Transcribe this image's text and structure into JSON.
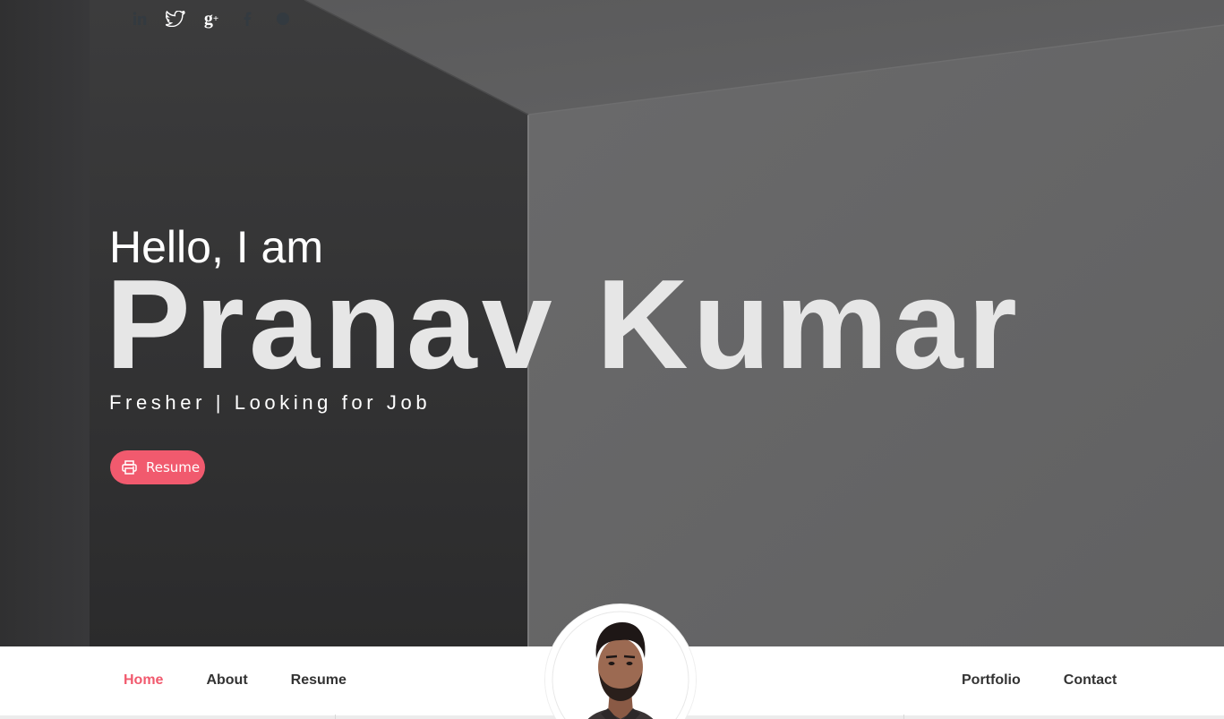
{
  "social": {
    "icons": [
      "linkedin-icon",
      "twitter-icon",
      "google-plus-icon",
      "facebook-icon",
      "skype-icon"
    ],
    "gplus_glyph": "g",
    "gplus_sup": "+"
  },
  "hero": {
    "greeting": "Hello, I am",
    "name": "Pranav Kumar",
    "tagline": "Fresher | Looking for Job",
    "resume_button": "Resume"
  },
  "nav": {
    "left": [
      {
        "label": "Home",
        "active": true
      },
      {
        "label": "About",
        "active": false
      },
      {
        "label": "Resume",
        "active": false
      }
    ],
    "right": [
      {
        "label": "Portfolio",
        "active": false
      },
      {
        "label": "Contact",
        "active": false
      }
    ]
  },
  "colors": {
    "accent": "#f15a6e",
    "nav_text": "#333333",
    "hero_text": "#ffffff"
  }
}
